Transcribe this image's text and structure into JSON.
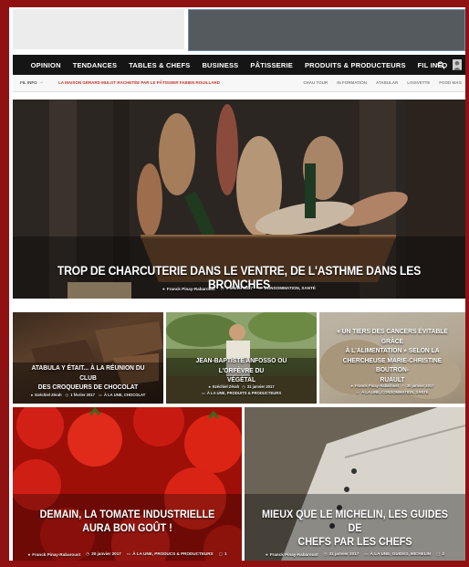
{
  "nav": {
    "items": [
      "OPINION",
      "TENDANCES",
      "TABLES & CHEFS",
      "BUSINESS",
      "PÂTISSERIE",
      "PRODUITS & PRODUCTEURS",
      "FIL INFO"
    ]
  },
  "ticker": {
    "label": "FIL INFO",
    "arrow": "→",
    "headline": "LA MAISON GÉRARD MULOT RACHETÉE PAR LE PÂTISSIER FABIEN ROUILLARD",
    "links": [
      "CHAU TOUR",
      "IN FORMATION",
      "ATABULAR",
      "LOISVETTE",
      "FOOD MAG"
    ]
  },
  "hero": {
    "title": "TROP DE CHARCUTERIE DANS LE VENTRE, DE L'ASTHME DANS LES BRONCHES",
    "author": "Franck Pinay-Rabaroust",
    "date": "1 février 2017",
    "category": "CONSOMMATION, SANTÉ"
  },
  "cards": [
    {
      "title_lines": [
        "ATABULA Y ÉTAIT... À LA RÉUNION DU CLUB",
        "DES CROQUEURS DE CHOCOLAT"
      ],
      "author": "Ezéchiel Zérah",
      "date": "1 février 2017",
      "category": "À LA UNE, CHOCOLAT"
    },
    {
      "title_lines": [
        "JEAN-BAPTISTE ANFOSSO OU L'ORFÈVRE DU",
        "VÉGÉTAL"
      ],
      "author": "Ezéchiel Zérah",
      "date": "31 janvier 2017",
      "category": "À LA UNE, PRODUITS & PRODUCTEURS"
    },
    {
      "title_lines": [
        "« UN TIERS DES CANCERS ÉVITABLE GRÂCE",
        "À L'ALIMENTATION » SELON LA",
        "CHERCHEUSE MARIE-CHRISTINE BOUTRON-",
        "RUAULT"
      ],
      "author": "Franck Pinay-Rabaroust",
      "date": "30 janvier 2017",
      "category": "À LA UNE, CONSOMMATION, SANTÉ"
    },
    {
      "title_lines": [
        "DEMAIN, LA TOMATE INDUSTRIELLE",
        "AURA BON GOÛT !"
      ],
      "author": "Franck Pinay-Rabaroust",
      "date": "30 janvier 2017",
      "category": "À LA UNE, PRODUCS & PRODUCTEURS",
      "comments": "1"
    },
    {
      "title_lines": [
        "MIEUX QUE LE MICHELIN, LES GUIDES DE",
        "CHEFS PAR LES CHEFS"
      ],
      "author": "Franck Pinay-Rabaroust",
      "date": "31 janvier 2017",
      "category": "À LA UNE, GUIDES, MICHELIN",
      "comments": "2"
    }
  ]
}
